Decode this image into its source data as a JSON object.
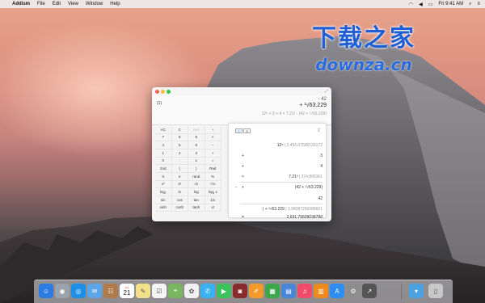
{
  "menubar": {
    "apple": "",
    "app_name": "Addism",
    "menus": [
      "File",
      "Edit",
      "View",
      "Window",
      "Help"
    ],
    "clock": "Fri 9:41 AM",
    "status_icons": [
      "wifi-icon",
      "volume-icon",
      "battery-icon",
      "search-icon",
      "list-icon"
    ]
  },
  "watermark": {
    "main": "下载之家",
    "sub": "downza.cn"
  },
  "window": {
    "display": {
      "tag": "(1)",
      "line1": "- 42",
      "line2": "+ ³√63.229",
      "line3": "12⁵ + 3 + 4 × 7.21³ - (42 + ³√63.229)"
    },
    "keypad": [
      "AC",
      "C",
      "Ans",
      "÷",
      "7",
      "8",
      "9",
      "×",
      "4",
      "5",
      "6",
      "−",
      "1",
      "2",
      "3",
      "+",
      "0",
      "·",
      "±",
      "=",
      "2nd",
      "(",
      ")",
      "Rad",
      "π",
      "e",
      "rand",
      "%",
      "x²",
      "xʸ",
      "√x",
      "ʸ√x",
      "log₂",
      "ln",
      "log",
      "logᵧ x",
      "sin",
      "cos",
      "tan",
      "1/x",
      "sinh",
      "cosh",
      "tanh",
      "x!"
    ],
    "keypad_dim": [
      "Ans"
    ],
    "tape": {
      "rows": [
        {
          "op": "",
          "value": "12⁵",
          "note": " | 2,456.67595120172"
        },
        {
          "op": "+",
          "value": "3",
          "note": ""
        },
        {
          "op": "+",
          "value": "4",
          "note": ""
        },
        {
          "op": "×",
          "value": "7.21³",
          "note": " | 374.805361"
        },
        {
          "op": "+",
          "value": "(42 + ³√63.229)",
          "note": "",
          "op2": "−"
        },
        {
          "op": "",
          "value": "42",
          "note": ""
        },
        {
          "op": "",
          "value": "+ ³√63.229",
          "note": " | 3.98087256088601",
          "prefix": "|"
        },
        {
          "op": "=",
          "value": "2,691.79609038788",
          "note": ""
        }
      ]
    }
  },
  "dock": {
    "calendar": {
      "day": "JUL",
      "date": "21"
    },
    "items": [
      "finder-icon",
      "launchpad-icon",
      "safari-icon",
      "mail-icon",
      "contacts-icon",
      "calendar-icon",
      "notes-icon",
      "reminders-icon",
      "maps-icon",
      "photos-icon",
      "messages-icon",
      "facetime-icon",
      "photo-booth-icon",
      "pages-icon",
      "numbers-icon",
      "keynote-icon",
      "itunes-icon",
      "ibooks-icon",
      "app-store-icon",
      "system-preferences-icon",
      "addism-icon",
      "downloads-folder-icon",
      "trash-icon"
    ]
  }
}
